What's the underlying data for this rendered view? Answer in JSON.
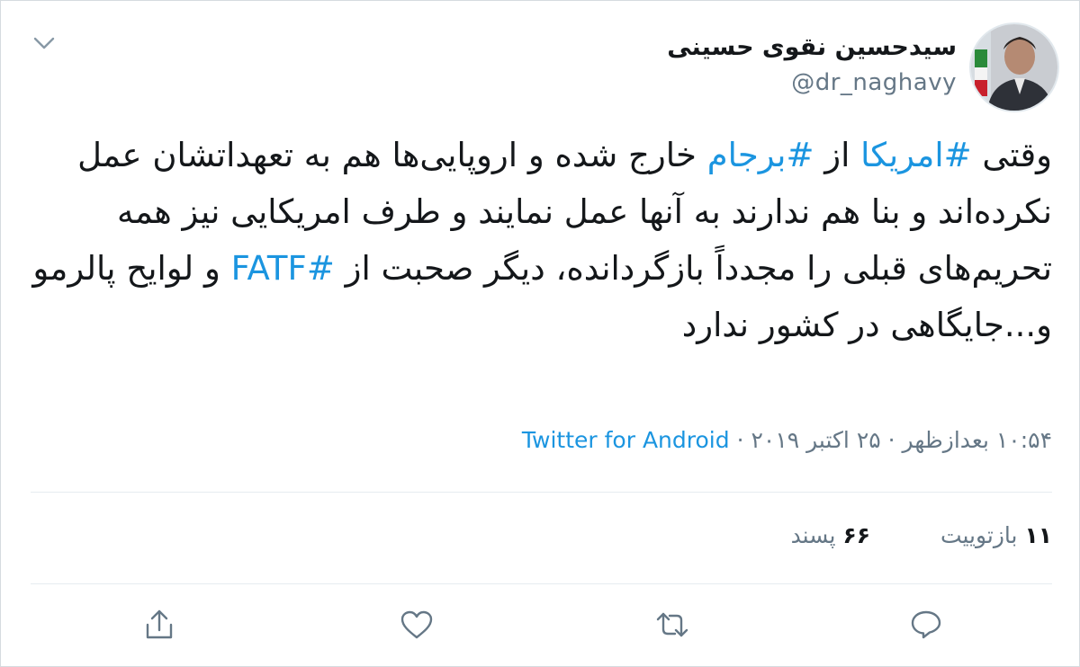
{
  "tweet": {
    "display_name": "سیدحسین نقوی حسینی",
    "handle": "@dr_naghavy",
    "text_parts": [
      {
        "t": "وقتی ",
        "h": false
      },
      {
        "t": "#امریکا",
        "h": true
      },
      {
        "t": " از ",
        "h": false
      },
      {
        "t": "#برجام",
        "h": true
      },
      {
        "t": " خارج شده و اروپایی‌ها هم به تعهداتشان عمل نکرده‌اند و بنا هم ندارند به آنها عمل نمایند و طرف امریکایی نیز همه تحریم‌های قبلی را مجدداً بازگردانده، دیگر صحبت از ",
        "h": false
      },
      {
        "t": "#FATF",
        "h": true
      },
      {
        "t": " و لوایح پالرمو و...جایگاهی در کشور ندارد",
        "h": false
      }
    ],
    "time": "۱۰:۵۴ بعدازظهر",
    "date": "۲۵ اکتبر ۲۰۱۹",
    "source": "Twitter for Android",
    "dot": "·",
    "retweets_count": "۱۱",
    "retweets_label": "بازتوییت",
    "likes_count": "۶۶",
    "likes_label": "پسند"
  },
  "colors": {
    "link": "#1b95e0",
    "secondary": "#657786",
    "icon": "#657786",
    "divider": "#e6ecf0"
  },
  "icons": {
    "menu": "chevron-down-icon",
    "reply": "reply-icon",
    "retweet": "retweet-icon",
    "like": "heart-icon",
    "share": "share-icon"
  }
}
